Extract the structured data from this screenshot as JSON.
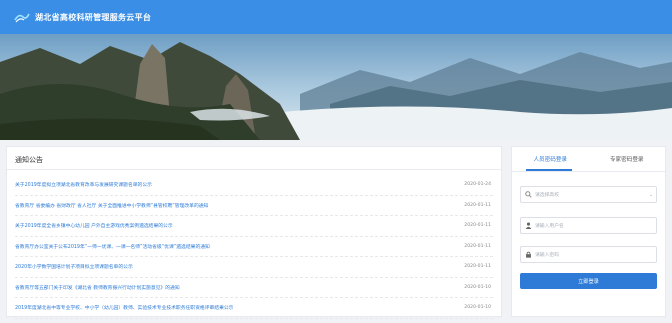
{
  "header": {
    "title": "湖北省高校科研管理服务云平台",
    "logo_icon": "logo-icon"
  },
  "notices": {
    "title": "通知公告",
    "items": [
      {
        "text": "关于2019年度拟立项湖北省教育改革与发展研究课题名单的公示",
        "date": "2020-01-24"
      },
      {
        "text": "省教育厅 省委编办 省财政厅 省人社厅 关于全面推进中小学教师“县管校聘”管理改革的通知",
        "date": "2020-01-11"
      },
      {
        "text": "关于2019年度全省乡镇中心幼儿园 户外自主游戏优秀案例遴选结果的公示",
        "date": "2020-01-11"
      },
      {
        "text": "省教育厅办公室关于公布2019年“一师一优课、一课一名师”活动省级“优课”遴选结果的通知",
        "date": "2020-01-11"
      },
      {
        "text": "2020年小学数学国培计划子项目拟立项课题名单的公示",
        "date": "2020-01-11"
      },
      {
        "text": "省教育厅等五部门关于印发《湖北省 教师教育振兴行动计划实施意见》的通知",
        "date": "2020-01-10"
      },
      {
        "text": "2019年度湖北省中等专业学校、中小学（幼儿园）教师、实验技术专业技术职务任职资格评审结果公示",
        "date": "2020-01-10"
      }
    ]
  },
  "login": {
    "tabs": [
      "人员密码登录",
      "专家密码登录"
    ],
    "school_placeholder": "请选择高校",
    "username_placeholder": "请输入用户名",
    "password_placeholder": "请输入密码",
    "submit_label": "立即登录"
  },
  "colors": {
    "accent": "#2d7bd6",
    "topbar": "#3a8ee6",
    "link": "#2d7bd6"
  }
}
